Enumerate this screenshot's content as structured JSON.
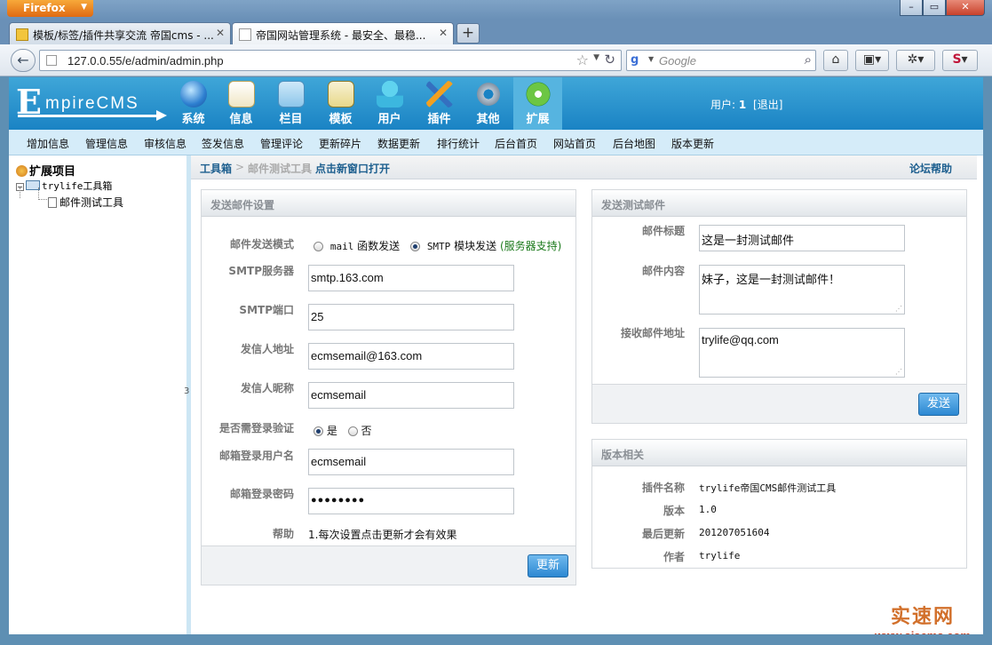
{
  "browser": {
    "menu_label": "Firefox",
    "tabs": [
      {
        "title": "模板/标签/插件共享交流 帝国cms - ..."
      },
      {
        "title": "帝国网站管理系统 - 最安全、最稳..."
      }
    ],
    "url": "127.0.0.55/e/admin/admin.php",
    "search_placeholder": "Google"
  },
  "cms": {
    "logo_rest": "mpireCMS",
    "logo_initial": "E",
    "nav": [
      {
        "label": "系统",
        "icon": "globe-icon"
      },
      {
        "label": "信息",
        "icon": "document-icon"
      },
      {
        "label": "栏目",
        "icon": "folder-icon"
      },
      {
        "label": "模板",
        "icon": "window-icon"
      },
      {
        "label": "用户",
        "icon": "user-icon"
      },
      {
        "label": "插件",
        "icon": "tools-icon"
      },
      {
        "label": "其他",
        "icon": "gear-icon"
      },
      {
        "label": "扩展",
        "icon": "plus-icon"
      }
    ],
    "user_label": "用户: ",
    "user_name": "1",
    "logout": "[退出]",
    "subnav": [
      "增加信息",
      "管理信息",
      "审核信息",
      "签发信息",
      "管理评论",
      "更新碎片",
      "数据更新",
      "排行统计",
      "后台首页",
      "网站首页",
      "后台地图",
      "版本更新"
    ]
  },
  "sidebar": {
    "root": "扩展项目",
    "folder": "trylife工具箱",
    "item": "邮件测试工具",
    "splitter_label": "3"
  },
  "breadcrumb": {
    "root": "工具箱",
    "sep": ">",
    "current": "邮件测试工具",
    "open_new": "点击新窗口打开",
    "help": "论坛帮助"
  },
  "settings": {
    "title": "发送邮件设置",
    "mode_label": "邮件发送模式",
    "mode_opt1_code": "mail",
    "mode_opt1": " 函数发送",
    "mode_opt2_code": "SMTP",
    "mode_opt2": " 模块发送",
    "mode_opt2_note": "(服务器支持)",
    "smtp_server_label": "SMTP服务器",
    "smtp_server": "smtp.163.com",
    "smtp_port_label": "SMTP端口",
    "smtp_port": "25",
    "from_label": "发信人地址",
    "from": "ecmsemail@163.com",
    "nick_label": "发信人昵称",
    "nick": "ecmsemail",
    "auth_label": "是否需登录验证",
    "auth_yes": "是",
    "auth_no": "否",
    "user_label": "邮箱登录用户名",
    "user": "ecmsemail",
    "pass_label": "邮箱登录密码",
    "pass": "●●●●●●●●",
    "help_label": "帮助",
    "help_text": "1.每次设置点击更新才会有效果",
    "update_button": "更新"
  },
  "test_mail": {
    "title": "发送测试邮件",
    "subject_label": "邮件标题",
    "subject": "这是一封测试邮件",
    "body_label": "邮件内容",
    "body": "妹子，这是一封测试邮件！",
    "to_label": "接收邮件地址",
    "to": "trylife@qq.com",
    "send_button": "发送"
  },
  "version": {
    "title": "版本相关",
    "name_label": "插件名称",
    "name": "trylife帝国CMS邮件测试工具",
    "ver_label": "版本",
    "ver": "1.0",
    "updated_label": "最后更新",
    "updated": "201207051604",
    "author_label": "作者",
    "author": "trylife"
  },
  "watermark": {
    "line1": "实速网",
    "line2": "www.siscms.com"
  }
}
